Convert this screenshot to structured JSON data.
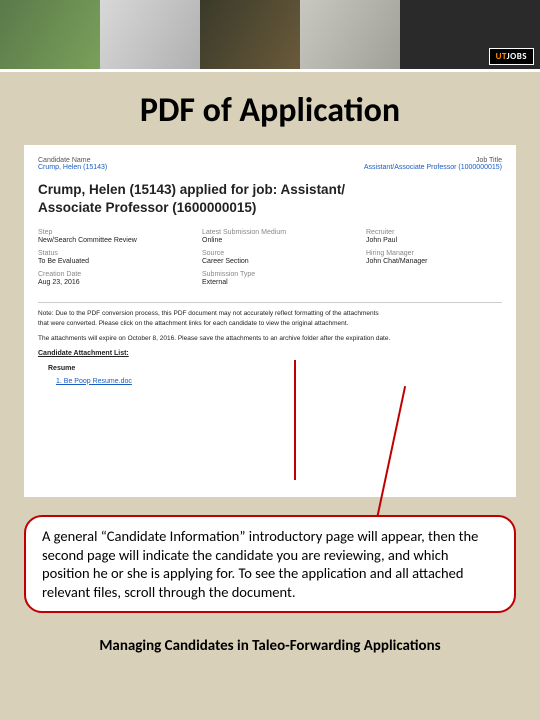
{
  "banner": {
    "logo_prefix": "UT",
    "logo_suffix": "JOBS"
  },
  "title": "PDF of Application",
  "pdf": {
    "left_label": "Candidate Name",
    "left_value": "Crump, Helen (15143)",
    "right_label": "Job Title",
    "right_value": "Assistant/Associate Professor (1000000015)",
    "applied_line1": "Crump, Helen (15143) applied for job: Assistant/",
    "applied_line2": "Associate Professor (1600000015)",
    "meta": {
      "c1": {
        "l1": "Step",
        "v1": "New/Search Committee Review",
        "l2": "Status",
        "v2": "To Be Evaluated",
        "l3": "Creation Date",
        "v3": "Aug 23, 2016"
      },
      "c2": {
        "l1": "Latest Submission Medium",
        "v1": "Online",
        "l2": "Source",
        "v2": "Career Section",
        "l3": "Submission Type",
        "v3": "External"
      },
      "c3": {
        "l1": "Recruiter",
        "v1": "John Paul",
        "l2": "Hiring Manager",
        "v2": "John Chat/Manager"
      }
    },
    "note_line1": "Note: Due to the PDF conversion process, this PDF document may not accurately reflect formatting of the attachments",
    "note_line2": "that were converted. Please click on the attachment links for each candidate to view the original attachment.",
    "note2": "The attachments will expire on October 8, 2016. Please save the attachments to an archive folder after the expiration date.",
    "attlist_label": "Candidate Attachment List:",
    "resume_label": "Resume",
    "file_link": "1. Be Poop Resume.doc"
  },
  "callout": "A general “Candidate Information” introductory page will appear, then the second page will indicate the candidate you are reviewing, and which position he or she is applying for. To see the application and all attached relevant files, scroll through the document.",
  "footer": "Managing Candidates in Taleo-Forwarding Applications"
}
